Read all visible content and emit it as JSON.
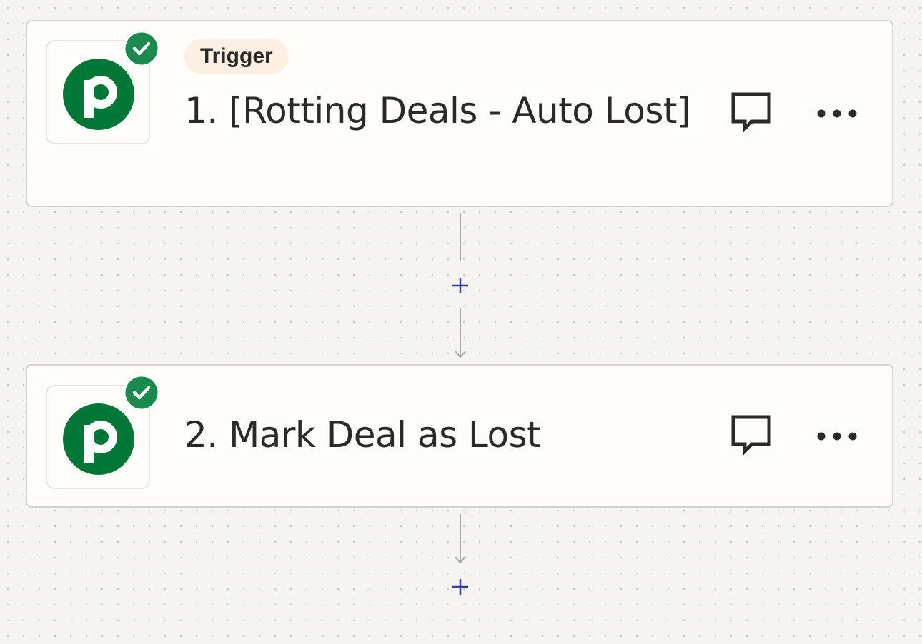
{
  "steps": [
    {
      "badge": "Trigger",
      "title": "1. [Rotting Deals - Auto Lost]",
      "app_icon": "pipedrive-logo",
      "status_icon": "check-circle-icon"
    },
    {
      "title": "2. Mark Deal as Lost",
      "app_icon": "pipedrive-logo",
      "status_icon": "check-circle-icon"
    }
  ],
  "icons": {
    "comment": "comment-icon",
    "more": "more-horizontal-icon",
    "add": "plus-icon",
    "arrow": "arrow-down-icon"
  },
  "colors": {
    "brand_green": "#017737",
    "success_green": "#1a8a4f",
    "trigger_pill_bg": "#fdf0e3",
    "add_icon": "#3a3aa0",
    "connector": "#a9a7a2"
  }
}
